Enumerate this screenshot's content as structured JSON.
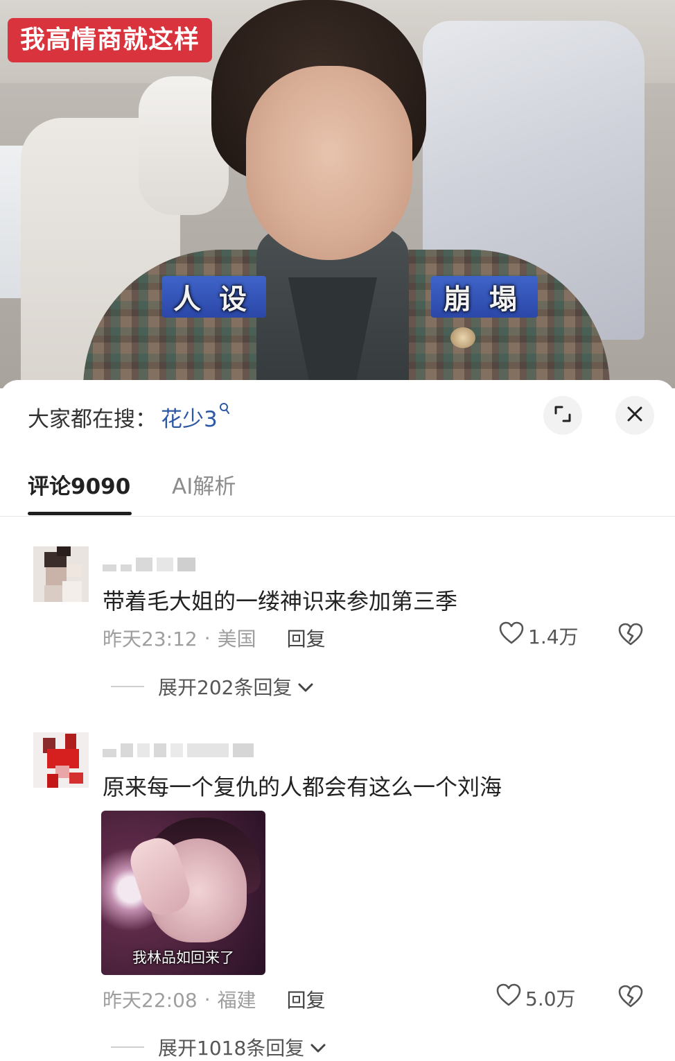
{
  "video": {
    "tag": "我高情商就这样",
    "overlay_left": "人设",
    "overlay_right": "崩塌"
  },
  "search": {
    "prefix": "大家都在搜：",
    "term": "花少3"
  },
  "tabs": [
    {
      "label": "评论9090",
      "active": true
    },
    {
      "label": "AI解析",
      "active": false
    }
  ],
  "comments": [
    {
      "text": "带着毛大姐的一缕神识来参加第三季",
      "time": "昨天23:12",
      "location": "美国",
      "reply_label": "回复",
      "likes": "1.4万",
      "expand": "展开202条回复"
    },
    {
      "text": "原来每一个复仇的人都会有这么一个刘海",
      "time": "昨天22:08",
      "location": "福建",
      "reply_label": "回复",
      "likes": "5.0万",
      "expand": "展开1018条回复",
      "image_caption": "我林品如回来了"
    }
  ],
  "icons": {
    "search": "magnifier-icon",
    "expand": "expand-icon",
    "close": "close-icon",
    "like": "heart-icon",
    "dislike": "broken-heart-icon",
    "chevron": "chevron-down-icon"
  },
  "colors": {
    "tag_bg": "#d9343d",
    "search_term": "#2d58a6",
    "meta_gray": "#9e9e9e"
  }
}
